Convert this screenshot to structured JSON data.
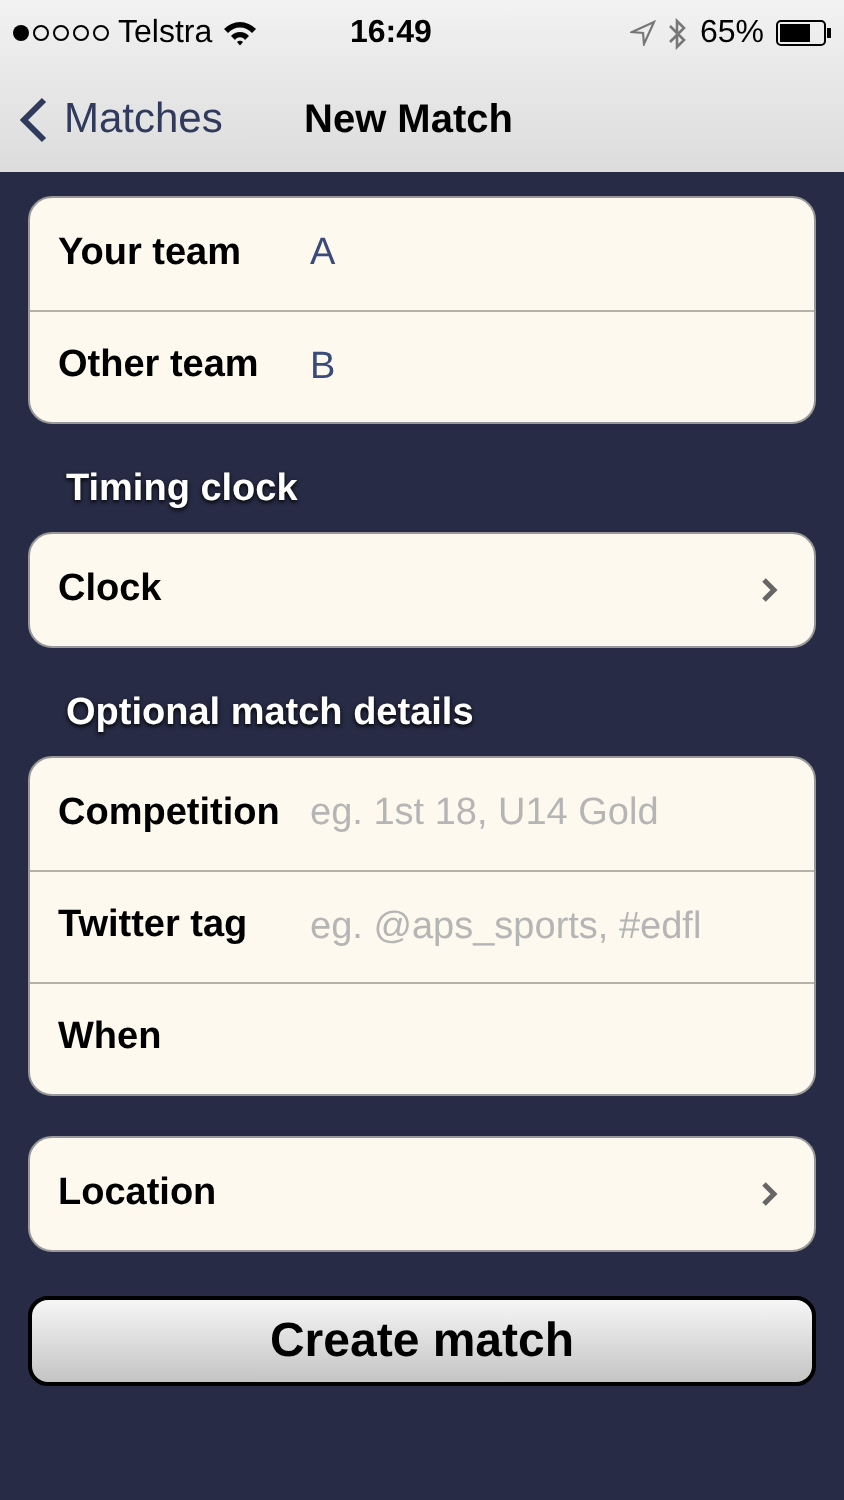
{
  "status_bar": {
    "carrier": "Telstra",
    "time": "16:49",
    "battery": "65%"
  },
  "nav": {
    "back": "Matches",
    "title": "New Match"
  },
  "sections": [
    {
      "rows": [
        {
          "kind": "field",
          "label": "Your team",
          "value": "A"
        },
        {
          "kind": "field",
          "label": "Other team",
          "value": "B"
        }
      ]
    },
    {
      "header": "Timing clock",
      "rows": [
        {
          "kind": "disclosure",
          "label": "Clock"
        }
      ]
    },
    {
      "header": "Optional match details",
      "rows": [
        {
          "kind": "field",
          "label": "Competition",
          "placeholder": "eg. 1st 18, U14 Gold"
        },
        {
          "kind": "field",
          "label": "Twitter tag",
          "placeholder": "eg. @aps_sports, #edfl"
        },
        {
          "kind": "field",
          "label": "When"
        }
      ]
    },
    {
      "rows": [
        {
          "kind": "disclosure",
          "label": "Location"
        }
      ]
    }
  ],
  "button": "Create match"
}
